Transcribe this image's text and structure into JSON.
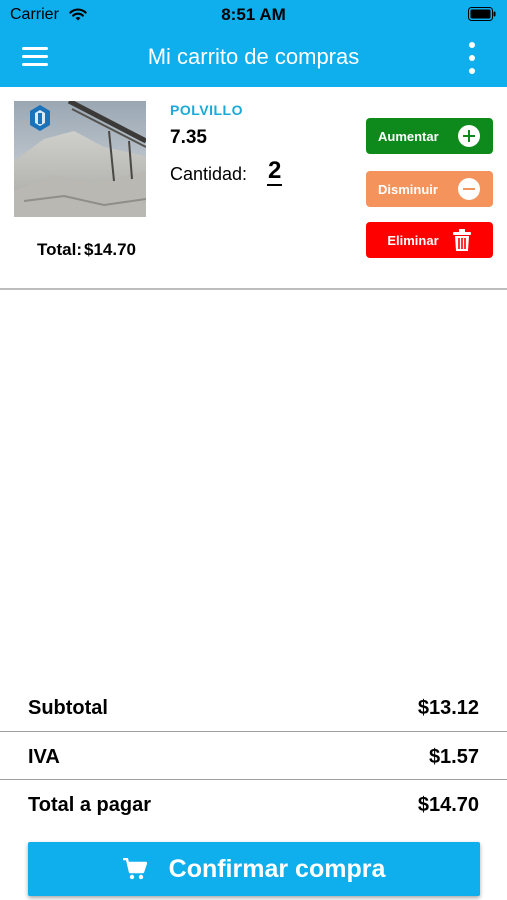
{
  "status_bar": {
    "carrier": "Carrier",
    "time": "8:51 AM"
  },
  "app_bar": {
    "title": "Mi carrito de compras",
    "menu_icon": "hamburger-menu-icon",
    "more_icon": "more-vertical-icon"
  },
  "cart_item": {
    "name": "POLVILLO",
    "price": "7.35",
    "quantity_label": "Cantidad:",
    "quantity": "2",
    "total_label": "Total:",
    "total_value": "$14.70",
    "buttons": {
      "increase": "Aumentar",
      "decrease": "Disminuir",
      "delete": "Eliminar"
    }
  },
  "summary": {
    "subtotal_label": "Subtotal",
    "subtotal_value": "$13.12",
    "iva_label": "IVA",
    "iva_value": "$1.57",
    "total_label": "Total a pagar",
    "total_value": "$14.70"
  },
  "confirm_button": {
    "label": "Confirmar compra",
    "icon": "cart-icon"
  },
  "colors": {
    "primary": "#0faeed",
    "increase": "#0e8a1c",
    "decrease": "#f4935c",
    "delete": "#fe0000",
    "product_name": "#1aaad6"
  }
}
